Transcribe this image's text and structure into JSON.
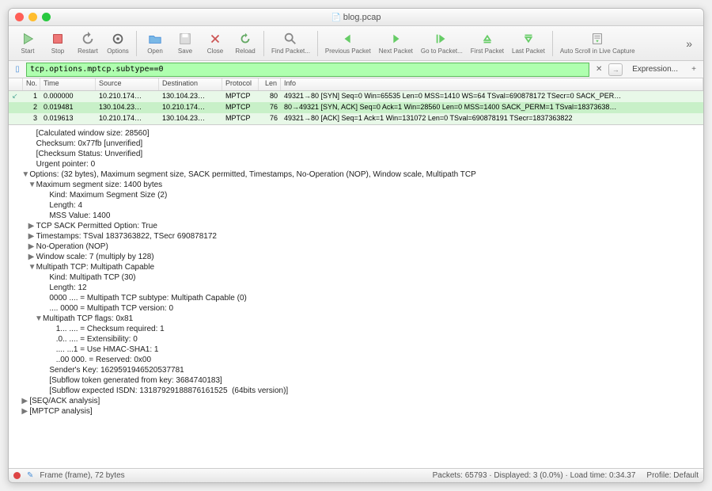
{
  "window": {
    "title": "blog.pcap"
  },
  "toolbar": {
    "start": "Start",
    "stop": "Stop",
    "restart": "Restart",
    "options": "Options",
    "open": "Open",
    "save": "Save",
    "close": "Close",
    "reload": "Reload",
    "find": "Find Packet...",
    "prev": "Previous Packet",
    "next": "Next Packet",
    "goto": "Go to Packet...",
    "first": "First Packet",
    "last": "Last Packet",
    "autoscroll": "Auto Scroll in Live Capture"
  },
  "filter": {
    "value": "tcp.options.mptcp.subtype==0",
    "expression": "Expression...",
    "clear": "✕",
    "plus": "+"
  },
  "columns": {
    "no": "No.",
    "time": "Time",
    "src": "Source",
    "dst": "Destination",
    "proto": "Protocol",
    "len": "Len",
    "info": "Info"
  },
  "packets": [
    {
      "mark": "↙",
      "no": "1",
      "time": "0.000000",
      "src": "10.210.174…",
      "dst": "130.104.23…",
      "proto": "MPTCP",
      "len": "80",
      "info": "49321→80 [SYN] Seq=0 Win=65535 Len=0 MSS=1410 WS=64 TSval=690878172 TSecr=0 SACK_PER…"
    },
    {
      "mark": "",
      "no": "2",
      "time": "0.019481",
      "src": "130.104.23…",
      "dst": "10.210.174…",
      "proto": "MPTCP",
      "len": "76",
      "info": "80→49321 [SYN, ACK] Seq=0 Ack=1 Win=28560 Len=0 MSS=1400 SACK_PERM=1 TSval=18373638…",
      "sel": true
    },
    {
      "mark": "",
      "no": "3",
      "time": "0.019613",
      "src": "10.210.174…",
      "dst": "130.104.23…",
      "proto": "MPTCP",
      "len": "76",
      "info": "49321→80 [ACK] Seq=1 Ack=1 Win=131072 Len=0 TSval=690878191 TSecr=1837363822"
    }
  ],
  "details": [
    {
      "i": 2,
      "t": "[Calculated window size: 28560]"
    },
    {
      "i": 2,
      "t": "Checksum: 0x77fb [unverified]"
    },
    {
      "i": 2,
      "t": "[Checksum Status: Unverified]"
    },
    {
      "i": 2,
      "t": "Urgent pointer: 0"
    },
    {
      "i": 1,
      "e": "▼",
      "t": "Options: (32 bytes), Maximum segment size, SACK permitted, Timestamps, No-Operation (NOP), Window scale, Multipath TCP"
    },
    {
      "i": 2,
      "e": "▼",
      "t": "Maximum segment size: 1400 bytes"
    },
    {
      "i": 4,
      "t": "Kind: Maximum Segment Size (2)"
    },
    {
      "i": 4,
      "t": "Length: 4"
    },
    {
      "i": 4,
      "t": "MSS Value: 1400"
    },
    {
      "i": 2,
      "e": "▶",
      "t": "TCP SACK Permitted Option: True"
    },
    {
      "i": 2,
      "e": "▶",
      "t": "Timestamps: TSval 1837363822, TSecr 690878172"
    },
    {
      "i": 2,
      "e": "▶",
      "t": "No-Operation (NOP)"
    },
    {
      "i": 2,
      "e": "▶",
      "t": "Window scale: 7 (multiply by 128)"
    },
    {
      "i": 2,
      "e": "▼",
      "t": "Multipath TCP: Multipath Capable"
    },
    {
      "i": 4,
      "t": "Kind: Multipath TCP (30)"
    },
    {
      "i": 4,
      "t": "Length: 12"
    },
    {
      "i": 4,
      "t": "0000 .... = Multipath TCP subtype: Multipath Capable (0)"
    },
    {
      "i": 4,
      "t": ".... 0000 = Multipath TCP version: 0"
    },
    {
      "i": 3,
      "e": "▼",
      "t": "Multipath TCP flags: 0x81"
    },
    {
      "i": 5,
      "t": "1... .... = Checksum required: 1"
    },
    {
      "i": 5,
      "t": ".0.. .... = Extensibility: 0"
    },
    {
      "i": 5,
      "t": ".... ...1 = Use HMAC-SHA1: 1"
    },
    {
      "i": 5,
      "t": "..00 000. = Reserved: 0x00"
    },
    {
      "i": 4,
      "t": "Sender's Key: 1629591946520537781"
    },
    {
      "i": 4,
      "t": "[Subflow token generated from key: 3684740183]"
    },
    {
      "i": 4,
      "t": "[Subflow expected ISDN: 13187929188876161525  (64bits version)]"
    },
    {
      "i": 1,
      "e": "▶",
      "t": "[SEQ/ACK analysis]"
    },
    {
      "i": 1,
      "e": "▶",
      "t": "[MPTCP analysis]"
    }
  ],
  "status": {
    "frame": "Frame (frame), 72 bytes",
    "packets": "Packets: 65793 · Displayed: 3 (0.0%) · Load time: 0:34.37",
    "profile": "Profile: Default"
  }
}
